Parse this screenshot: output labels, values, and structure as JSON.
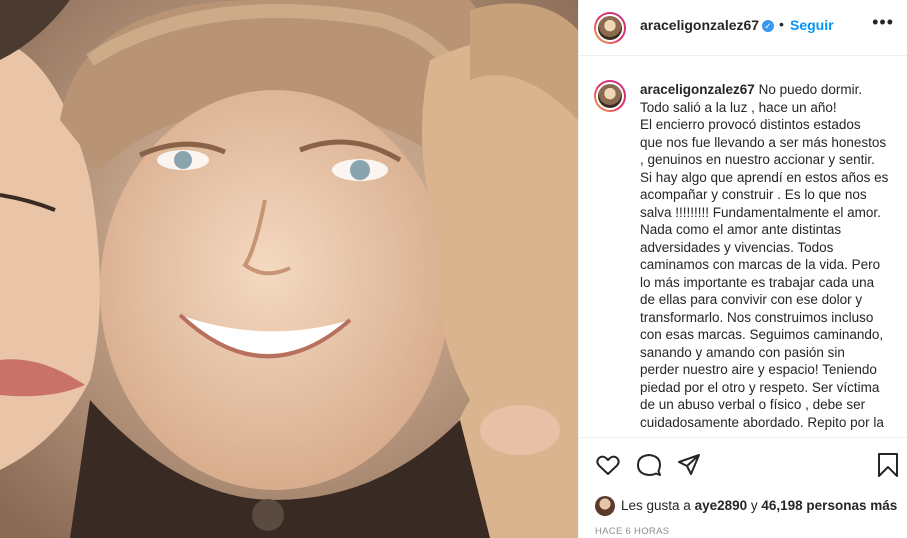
{
  "post": {
    "username": "araceligonzalez67",
    "verified_glyph": "✓",
    "dot": "•",
    "follow_label": "Seguir",
    "more_label": "•••",
    "image_alt_icon": "photo-of-smiling-child"
  },
  "caption": {
    "username": "araceligonzalez67",
    "lines": [
      "No puedo dormir.",
      "Todo salió a la luz , hace un año!",
      "El encierro provocó distintos estados",
      "que nos fue llevando a ser más honestos",
      ", genuinos en nuestro accionar y sentir.",
      "Si hay algo que aprendí en estos años es",
      "acompañar y construir . Es lo que nos",
      "salva !!!!!!!!! Fundamentalmente el amor.",
      "Nada como el amor ante distintas",
      "adversidades y vivencias. Todos",
      "caminamos con marcas de la vida. Pero",
      "lo más importante es trabajar cada una",
      "de ellas para convivir con ese dolor y",
      "transformarlo. Nos construimos incluso",
      "con esas marcas. Seguimos caminando,",
      "sanando y amando con pasión sin",
      "perder nuestro aire y espacio! Teniendo",
      "piedad por el otro y respeto. Ser víctima",
      "de un abuso verbal o físico , debe ser",
      "cuidadosamente abordado. Repito por la"
    ]
  },
  "actions": {
    "like_icon": "heart-icon",
    "comment_icon": "comment-icon",
    "share_icon": "share-icon",
    "save_icon": "bookmark-icon"
  },
  "likes": {
    "prefix": "Les gusta a ",
    "user": "aye2890",
    "middle": " y ",
    "count": "46,198 personas más"
  },
  "timestamp": "HACE 6 HORAS",
  "colors": {
    "link_blue": "#0095f6",
    "verified_blue": "#3897f0",
    "muted": "#8e8e8e",
    "text": "#262626"
  }
}
